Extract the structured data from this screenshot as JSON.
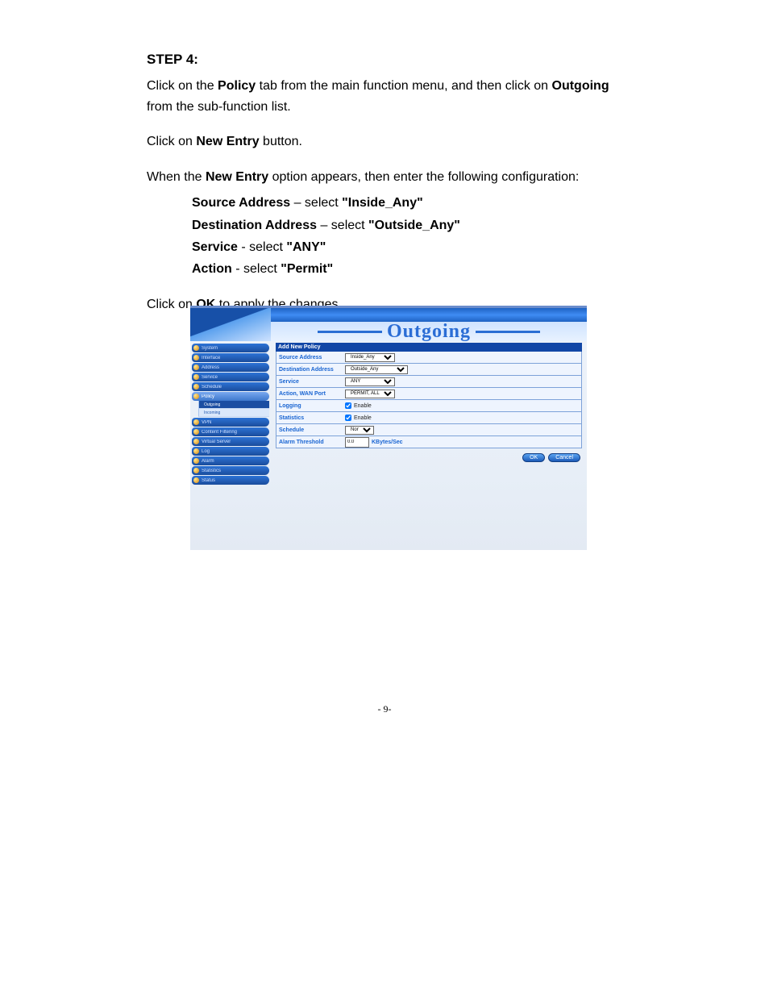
{
  "step": {
    "heading": "STEP 4:",
    "p1a": "Click on the ",
    "p1b": "Policy",
    "p1c": " tab from the main function menu, and then click on ",
    "p1d": "Outgoing",
    "p1e": " from the sub-function list.",
    "p2a": "Click on ",
    "p2b": "New Entry",
    "p2c": " button.",
    "p3a": "When the ",
    "p3b": "New Entry",
    "p3c": " option appears, then enter the following configuration:",
    "cfg": {
      "l1a": "Source Address",
      "l1b": " – select ",
      "l1c": "\"Inside_Any\"",
      "l2a": "Destination Address",
      "l2b": " – select ",
      "l2c": "\"Outside_Any\"",
      "l3a": "Service",
      "l3b": " - select ",
      "l3c": "\"ANY\"",
      "l4a": "Action",
      "l4b": " - select   ",
      "l4c": "\"Permit\""
    },
    "p4a": "Click on ",
    "p4b": "OK",
    "p4c": " to apply the changes."
  },
  "shot": {
    "title": "Outgoing",
    "sidebar": {
      "items": [
        {
          "label": "System"
        },
        {
          "label": "Interface"
        },
        {
          "label": "Address"
        },
        {
          "label": "Service"
        },
        {
          "label": "Schedule"
        },
        {
          "label": "Policy",
          "open": true,
          "sub": [
            {
              "label": "Outgoing",
              "active": true
            },
            {
              "label": "Incoming"
            }
          ]
        },
        {
          "label": "VPN"
        },
        {
          "label": "Content Filtering"
        },
        {
          "label": "Virtual Server"
        },
        {
          "label": "Log"
        },
        {
          "label": "Alarm"
        },
        {
          "label": "Statistics"
        },
        {
          "label": "Status"
        }
      ]
    },
    "form": {
      "header": "Add New Policy",
      "rows": {
        "source": {
          "label": "Source Address",
          "value": "Inside_Any"
        },
        "dest": {
          "label": "Destination Address",
          "value": "Outside_Any"
        },
        "service": {
          "label": "Service",
          "value": "ANY"
        },
        "action": {
          "label": "Action, WAN Port",
          "value": "PERMIT, ALL"
        },
        "logging": {
          "label": "Logging",
          "enable": "Enable"
        },
        "stats": {
          "label": "Statistics",
          "enable": "Enable"
        },
        "schedule": {
          "label": "Schedule",
          "value": "None"
        },
        "alarm": {
          "label": "Alarm Threshold",
          "value": "0.0",
          "unit": "KBytes/Sec"
        }
      },
      "buttons": {
        "ok": "OK",
        "cancel": "Cancel"
      }
    }
  },
  "page": {
    "num": "- 9-"
  }
}
